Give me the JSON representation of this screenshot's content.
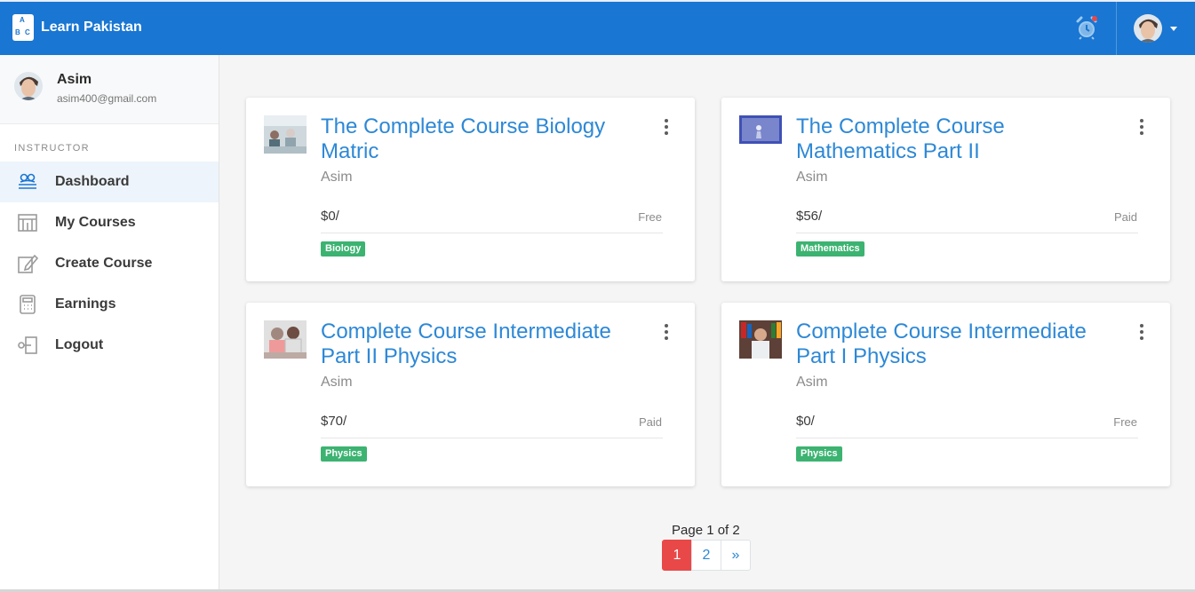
{
  "app": {
    "name": "Learn Pakistan",
    "logo_letters": [
      "A",
      "B",
      "C"
    ]
  },
  "user": {
    "name": "Asim",
    "email": "asim400@gmail.com"
  },
  "sidebar": {
    "section_title": "INSTRUCTOR",
    "items": [
      {
        "label": "Dashboard",
        "icon": "dashboard-icon",
        "active": true
      },
      {
        "label": "My Courses",
        "icon": "courses-icon",
        "active": false
      },
      {
        "label": "Create Course",
        "icon": "edit-icon",
        "active": false
      },
      {
        "label": "Earnings",
        "icon": "calculator-icon",
        "active": false
      },
      {
        "label": "Logout",
        "icon": "logout-icon",
        "active": false
      }
    ]
  },
  "courses": [
    {
      "title": "The Complete Course Biology Matric",
      "author": "Asim",
      "price": "$0/",
      "status": "Free",
      "tag": "Biology",
      "thumb": "classroom-thumbnail"
    },
    {
      "title": "The Complete Course Mathematics Part II",
      "author": "Asim",
      "price": "$56/",
      "status": "Paid",
      "tag": "Mathematics",
      "thumb": "screen-thumbnail"
    },
    {
      "title": "Complete Course Intermediate Part II Physics",
      "author": "Asim",
      "price": "$70/",
      "status": "Paid",
      "tag": "Physics",
      "thumb": "students-thumbnail"
    },
    {
      "title": "Complete Course Intermediate Part I Physics",
      "author": "Asim",
      "price": "$0/",
      "status": "Free",
      "tag": "Physics",
      "thumb": "library-thumbnail"
    }
  ],
  "pagination": {
    "info": "Page 1 of 2",
    "pages": [
      "1",
      "2"
    ],
    "next": "»"
  },
  "colors": {
    "primary": "#1976d2",
    "link": "#2d88d6",
    "tag": "#3cb371",
    "active_page": "#e94848"
  }
}
